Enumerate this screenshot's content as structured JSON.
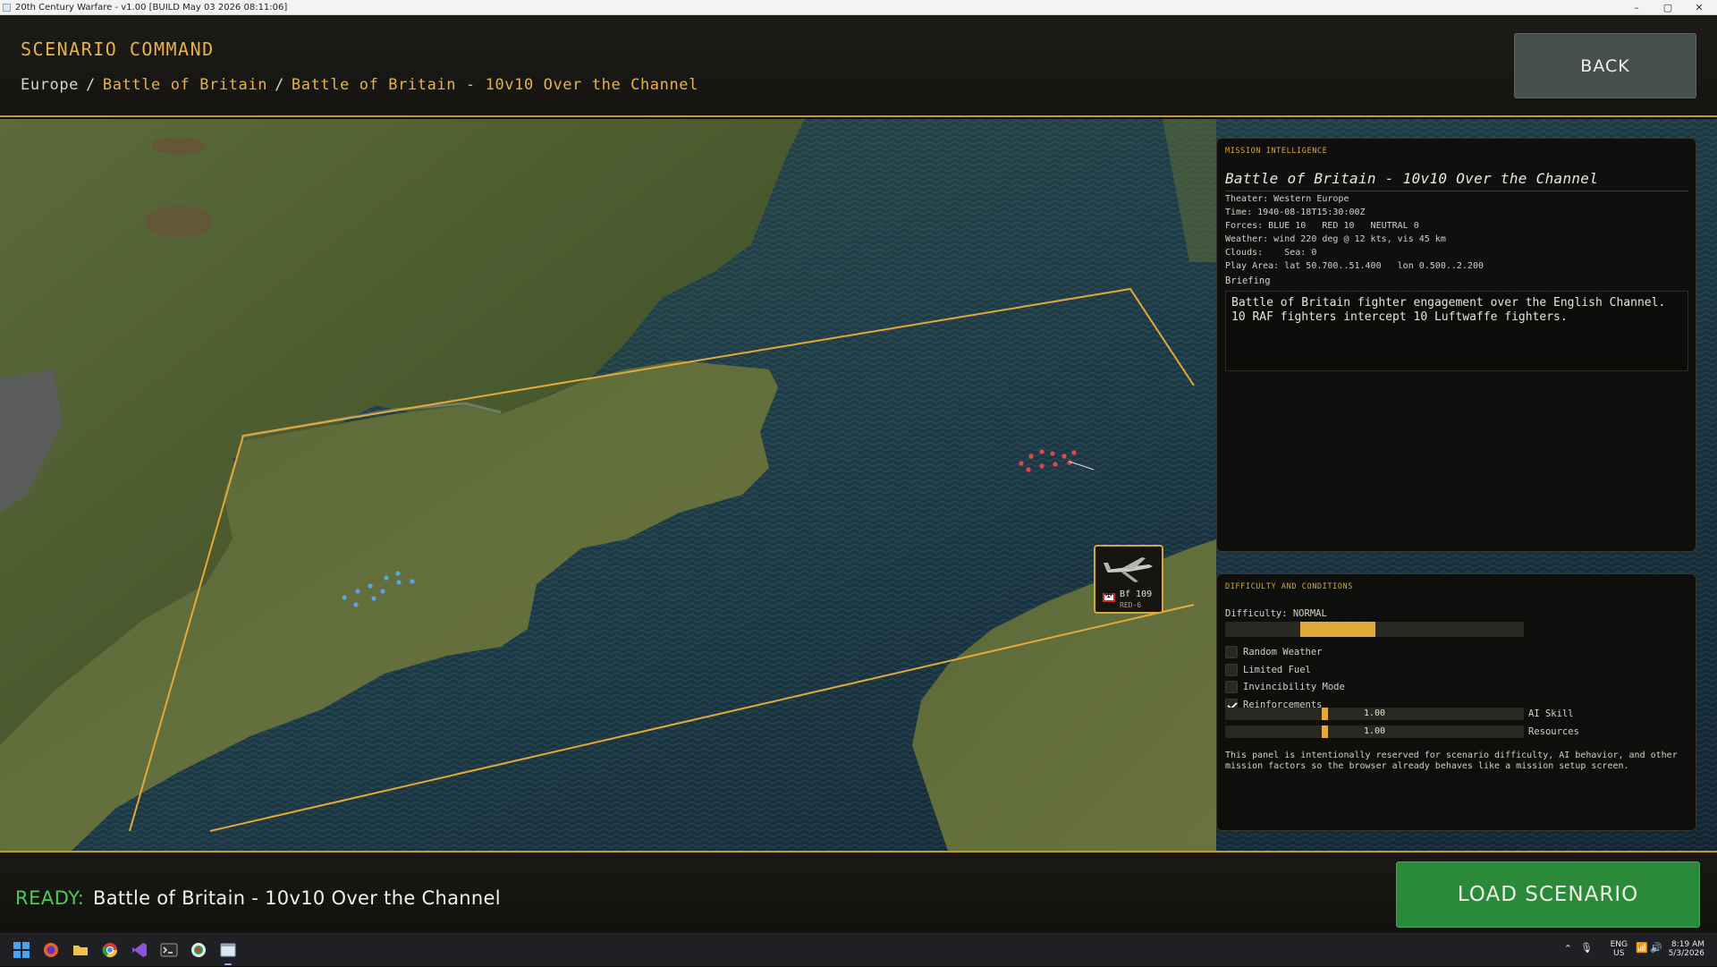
{
  "window": {
    "title": "20th Century Warfare - v1.00 [BUILD May 03 2026 08:11:06]",
    "controls": {
      "minimize": "–",
      "maximize": "▢",
      "close": "✕"
    }
  },
  "header": {
    "title": "SCENARIO COMMAND",
    "breadcrumb": [
      "Europe",
      "Battle of Britain",
      "Battle of Britain - 10v10 Over the Channel"
    ],
    "separator": "/",
    "back_label": "BACK"
  },
  "map": {
    "unit_card": {
      "type": "Bf 109",
      "callsign": "RED-6",
      "icon": "aircraft-icon",
      "flag_icon": "german-flag-icon"
    },
    "colors": {
      "blue_force": "#5aa3e8",
      "red_force": "#e24848",
      "play_area": "#e3a93a"
    }
  },
  "intel": {
    "heading": "MISSION INTELLIGENCE",
    "title": "Battle of Britain - 10v10 Over the Channel",
    "lines": [
      "Theater: Western Europe",
      "Time: 1940-08-18T15:30:00Z",
      "Forces: BLUE 10   RED 10   NEUTRAL 0",
      "Weather: wind 220 deg @ 12 kts, vis 45 km",
      "Clouds:    Sea: 0",
      "Play Area: lat 50.700..51.400   lon 0.500..2.200"
    ],
    "briefing_label": "Briefing",
    "briefing": "Battle of Britain fighter engagement over the English Channel. 10 RAF fighters intercept 10 Luftwaffe fighters."
  },
  "difficulty": {
    "heading": "DIFFICULTY AND CONDITIONS",
    "label": "Difficulty: NORMAL",
    "level_fraction": 0.25,
    "options": [
      {
        "label": "Random Weather",
        "checked": false
      },
      {
        "label": "Limited Fuel",
        "checked": false
      },
      {
        "label": "Invincibility Mode",
        "checked": false
      },
      {
        "label": "Reinforcements",
        "checked": true
      }
    ],
    "sliders": [
      {
        "name": "AI Skill",
        "value": "1.00",
        "fraction": 0.33
      },
      {
        "name": "Resources",
        "value": "1.00",
        "fraction": 0.33
      }
    ],
    "note": "This panel is intentionally reserved for scenario difficulty, AI behavior, and other mission factors so the browser already behaves like a mission setup screen."
  },
  "footer": {
    "status_label": "READY:",
    "scenario_name": "Battle of Britain - 10v10 Over the Channel",
    "load_label": "LOAD SCENARIO",
    "colors": {
      "ready": "#4ec95a",
      "load_button": "#2b8a3a"
    }
  },
  "taskbar": {
    "apps": [
      "windows-start-icon",
      "firefox-icon",
      "file-explorer-icon",
      "chrome-icon",
      "visual-studio-icon",
      "terminal-icon",
      "chrome-alt-icon",
      "game-window-icon"
    ],
    "language": "ENG",
    "region": "US",
    "time": "8:19 AM",
    "date": "5/3/2026"
  }
}
